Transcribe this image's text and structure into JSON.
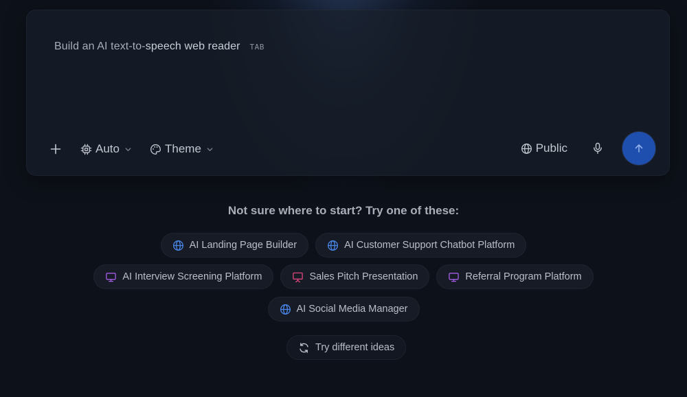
{
  "prompt": {
    "text_part1": "Build an AI text-to-",
    "text_part2": "speech web reader",
    "tab_hint": "TAB"
  },
  "toolbar": {
    "add_icon": "plus-icon",
    "model": {
      "label": "Auto",
      "icon": "chip-icon"
    },
    "theme": {
      "label": "Theme",
      "icon": "palette-icon"
    },
    "visibility": {
      "label": "Public",
      "icon": "globe-icon"
    },
    "mic_icon": "microphone-icon",
    "send_icon": "arrow-up-icon"
  },
  "suggestions": {
    "title": "Not sure where to start? Try one of these:",
    "chips": [
      {
        "label": "AI Landing Page Builder",
        "icon": "globe-icon",
        "color": "#4a86e8"
      },
      {
        "label": "AI Customer Support Chatbot Platform",
        "icon": "globe-icon",
        "color": "#4a86e8"
      },
      {
        "label": "AI Interview Screening Platform",
        "icon": "monitor-icon",
        "color": "#a55de6"
      },
      {
        "label": "Sales Pitch Presentation",
        "icon": "presentation-icon",
        "color": "#e0457b"
      },
      {
        "label": "Referral Program Platform",
        "icon": "monitor-icon",
        "color": "#a55de6"
      },
      {
        "label": "AI Social Media Manager",
        "icon": "globe-icon",
        "color": "#4a86e8"
      }
    ],
    "try_different": "Try different ideas"
  },
  "colors": {
    "background": "#0d1119",
    "send_button": "#1f4fae",
    "globe_accent": "#4a86e8",
    "monitor_accent": "#a55de6",
    "presentation_accent": "#e0457b"
  }
}
